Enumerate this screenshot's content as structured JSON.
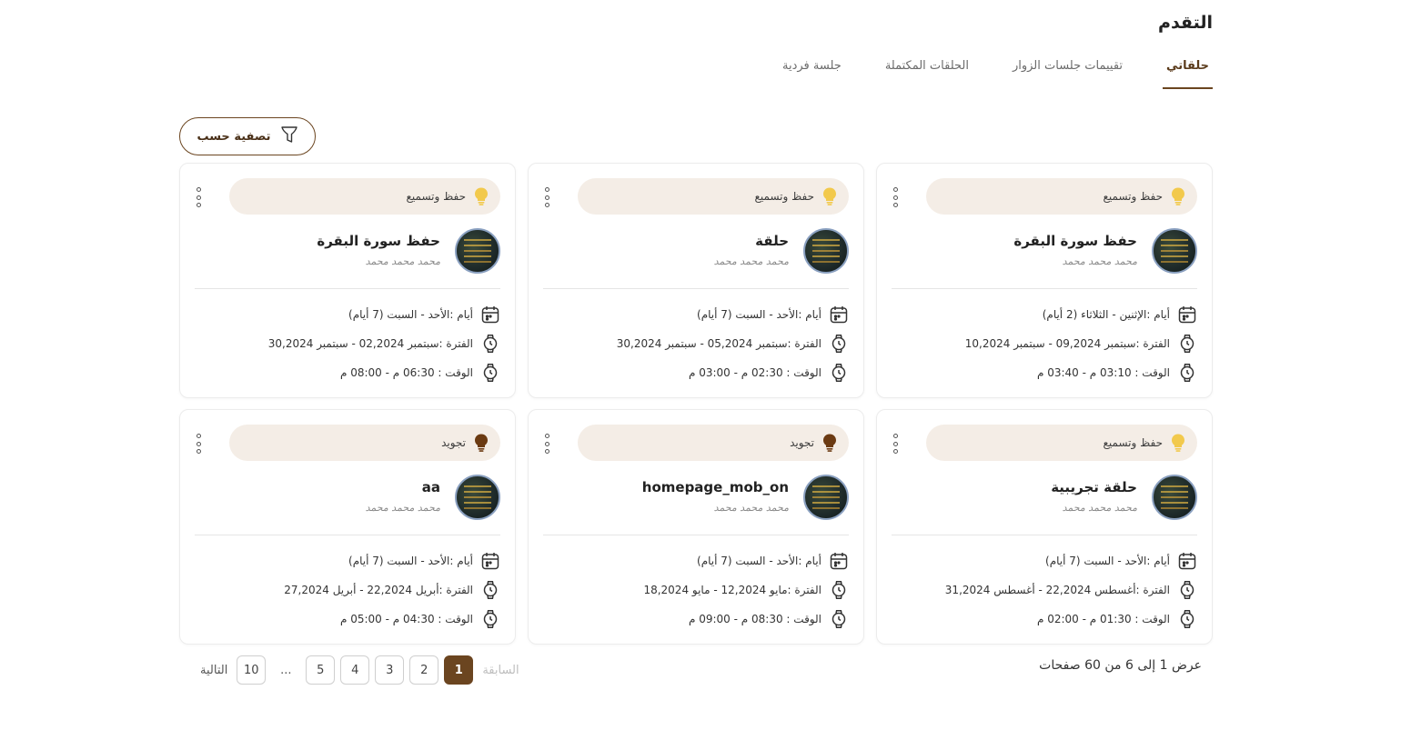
{
  "page": {
    "title": "التقدم"
  },
  "tabs": [
    {
      "label": "حلقاتي",
      "active": true
    },
    {
      "label": "تقييمات جلسات الزوار",
      "active": false
    },
    {
      "label": "الحلقات المكتملة",
      "active": false
    },
    {
      "label": "جلسة فردية",
      "active": false
    }
  ],
  "filter": {
    "label": "تصفية حسب",
    "icon": "filter-icon"
  },
  "colors": {
    "brand": "#6b4520",
    "tag_bg": "#f4ede6",
    "bulb_yellow": "#f2c94c",
    "bulb_brown": "#6b3a12"
  },
  "cards": [
    {
      "tag": "حفظ وتسميع",
      "bulb": "yellow",
      "title": "حفظ سورة البقرة",
      "subtitle": "محمد محمد محمد",
      "days": "أيام :الإثنين - الثلاثاء (2 أيام)",
      "period": "الفترة :سبتمبر 09,2024 - سبتمبر 10,2024",
      "time": "الوقت : 03:10 م - 03:40 م"
    },
    {
      "tag": "حفظ وتسميع",
      "bulb": "yellow",
      "title": "حلقة",
      "subtitle": "محمد محمد محمد",
      "days": "أيام :الأحد - السبت (7 أيام)",
      "period": "الفترة :سبتمبر 05,2024 - سبتمبر 30,2024",
      "time": "الوقت : 02:30 م - 03:00 م"
    },
    {
      "tag": "حفظ وتسميع",
      "bulb": "yellow",
      "title": "حفظ سورة البقرة",
      "subtitle": "محمد محمد محمد",
      "days": "أيام :الأحد - السبت (7 أيام)",
      "period": "الفترة :سبتمبر 02,2024 - سبتمبر 30,2024",
      "time": "الوقت : 06:30 م - 08:00 م"
    },
    {
      "tag": "حفظ وتسميع",
      "bulb": "yellow",
      "title": "حلقة تجريبية",
      "subtitle": "محمد محمد محمد",
      "days": "أيام :الأحد - السبت (7 أيام)",
      "period": "الفترة :أغسطس 22,2024 - أغسطس 31,2024",
      "time": "الوقت : 01:30 م - 02:00 م"
    },
    {
      "tag": "تجويد",
      "bulb": "brown",
      "title": "homepage_mob_on",
      "subtitle": "محمد محمد محمد",
      "days": "أيام :الأحد - السبت (7 أيام)",
      "period": "الفترة :مايو 12,2024 - مايو 18,2024",
      "time": "الوقت : 08:30 م - 09:00 م"
    },
    {
      "tag": "تجويد",
      "bulb": "brown",
      "title": "aa",
      "subtitle": "محمد محمد محمد",
      "days": "أيام :الأحد - السبت (7 أيام)",
      "period": "الفترة :أبريل 22,2024 - أبريل 27,2024",
      "time": "الوقت : 04:30 م - 05:00 م"
    }
  ],
  "summary": "عرض 1 إلى 6 من 60 صفحات",
  "pagination": {
    "prev": "السابقة",
    "pages": [
      "1",
      "2",
      "3",
      "4",
      "5"
    ],
    "active": "1",
    "ellipsis": "...",
    "last": "10",
    "next": "التالية"
  }
}
